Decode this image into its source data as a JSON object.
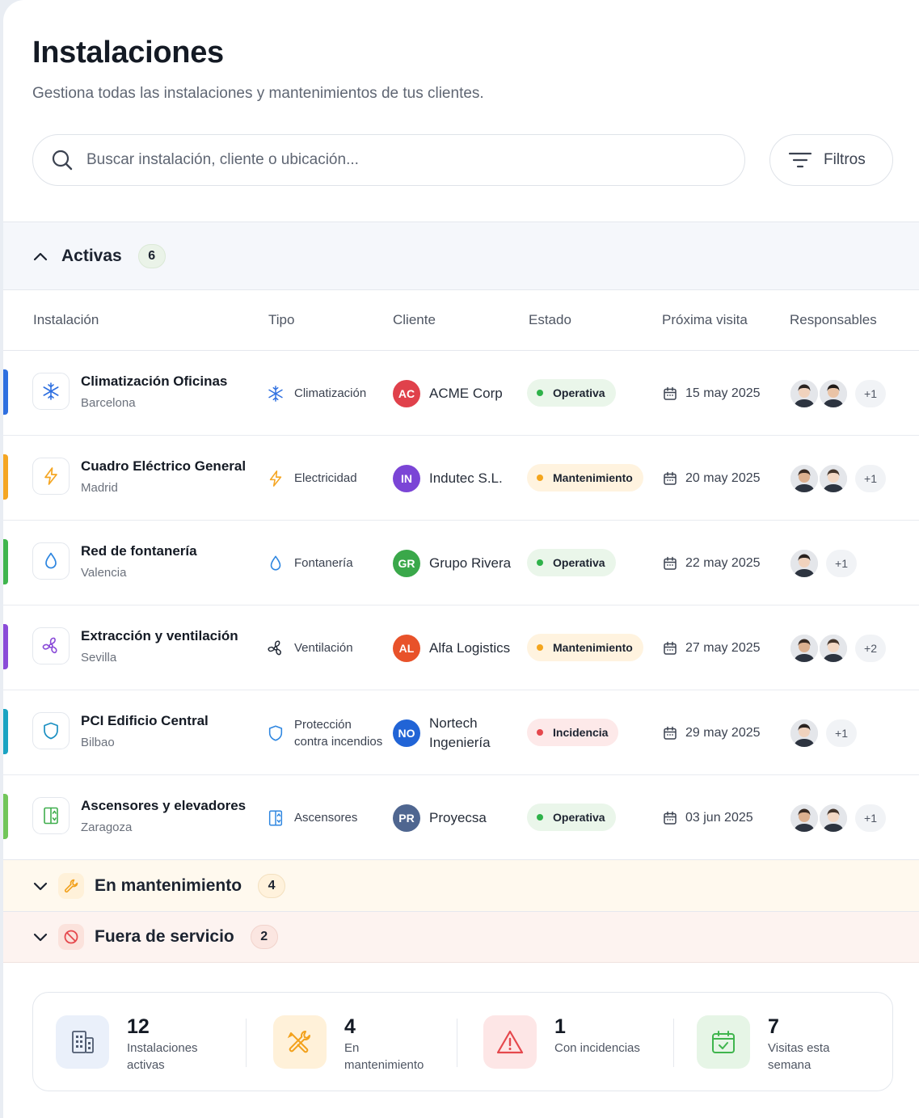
{
  "header": {
    "title": "Instalaciones",
    "subtitle": "Gestiona todas las instalaciones y mantenimientos de tus clientes."
  },
  "search": {
    "placeholder": "Buscar instalación, cliente o ubicación..."
  },
  "filters_label": "Filtros",
  "groups": {
    "active": {
      "label": "Activas",
      "count": "6"
    },
    "maintenance": {
      "label": "En mantenimiento",
      "count": "4"
    },
    "out_of_service": {
      "label": "Fuera de servicio",
      "count": "2"
    }
  },
  "columns": [
    "Instalación",
    "Tipo",
    "Cliente",
    "Estado",
    "Próxima visita",
    "Responsables"
  ],
  "rows": [
    {
      "name": "Climatización Oficinas",
      "location": "Barcelona",
      "type": "Climatización",
      "type_icon": "snowflake-icon",
      "client_initials": "AC",
      "client": "ACME Corp",
      "client_color": "#e0414b",
      "status": "Operativa",
      "status_kind": "operativa",
      "date": "15 may 2025",
      "responsables_extra": "+1",
      "accent": "#2e6fe0"
    },
    {
      "name": "Cuadro Eléctrico General",
      "location": "Madrid",
      "type": "Electricidad",
      "type_icon": "lightning-icon",
      "client_initials": "IN",
      "client": "Indutec S.L.",
      "client_color": "#7b45d6",
      "status": "Mantenimiento",
      "status_kind": "mantenimiento",
      "date": "20 may 2025",
      "responsables_extra": "+1",
      "accent": "#f5a623"
    },
    {
      "name": "Red de fontanería",
      "location": "Valencia",
      "type": "Fontanería",
      "type_icon": "water-drop-icon",
      "client_initials": "GR",
      "client": "Grupo Rivera",
      "client_color": "#3aa84a",
      "status": "Operativa",
      "status_kind": "operativa",
      "date": "22 may 2025",
      "responsables_extra": "+1",
      "accent": "#3fb54d"
    },
    {
      "name": "Extracción y ventilación",
      "location": "Sevilla",
      "type": "Ventilación",
      "type_icon": "fan-icon",
      "client_initials": "AL",
      "client": "Alfa Logistics",
      "client_color": "#e8522a",
      "status": "Mantenimiento",
      "status_kind": "mantenimiento",
      "date": "27 may 2025",
      "responsables_extra": "+2",
      "accent": "#8a4bd8"
    },
    {
      "name": "PCI Edificio Central",
      "location": "Bilbao",
      "type": "Protección contra incendios",
      "type_icon": "shield-icon",
      "client_initials": "NO",
      "client": "Nortech Ingeniería",
      "client_color": "#2164d6",
      "status": "Incidencia",
      "status_kind": "incidencia",
      "date": "29 may 2025",
      "responsables_extra": "+1",
      "accent": "#1aa3c2"
    },
    {
      "name": "Ascensores y elevadores",
      "location": "Zaragoza",
      "type": "Ascensores",
      "type_icon": "elevator-icon",
      "client_initials": "PR",
      "client": "Proyecsa",
      "client_color": "#4f6690",
      "status": "Operativa",
      "status_kind": "operativa",
      "date": "03 jun 2025",
      "responsables_extra": "+1",
      "accent": "#72c65a"
    }
  ],
  "stats": [
    {
      "value": "12",
      "label": "Instalaciones activas",
      "icon": "building-icon"
    },
    {
      "value": "4",
      "label": "En mantenimiento",
      "icon": "tools-icon"
    },
    {
      "value": "1",
      "label": "Con incidencias",
      "icon": "warning-icon"
    },
    {
      "value": "7",
      "label": "Visitas esta semana",
      "icon": "calendar-check-icon"
    }
  ],
  "colors": {
    "operativa": "#2fb24a",
    "mantenimiento": "#f4a51c",
    "incidencia": "#e5484d",
    "accent_blue": "#2e6fe0"
  }
}
